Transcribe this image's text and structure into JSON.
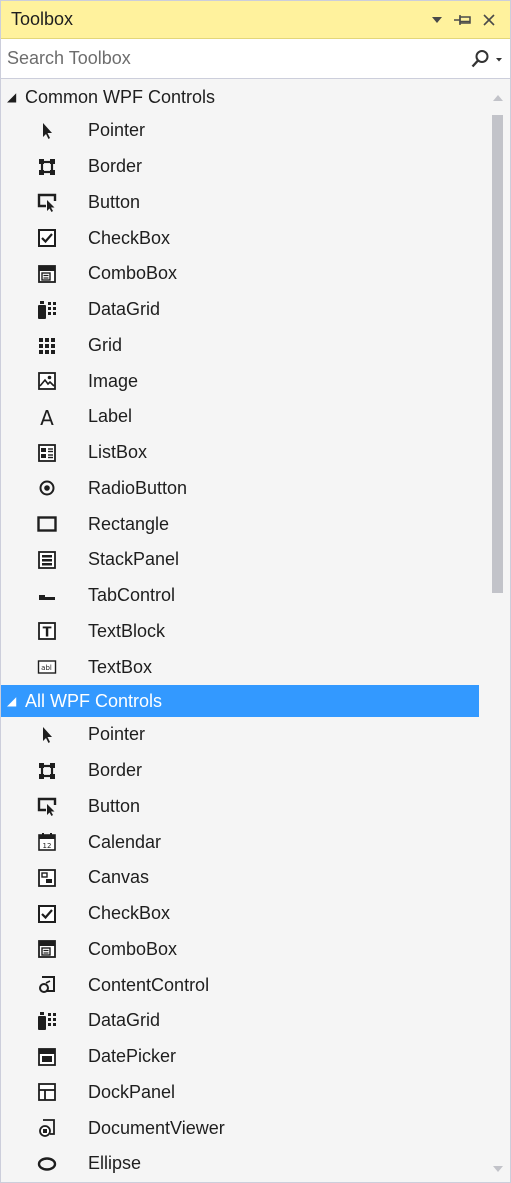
{
  "panel": {
    "title": "Toolbox"
  },
  "search": {
    "placeholder": "Search Toolbox"
  },
  "groups": [
    {
      "label": "Common WPF Controls",
      "items": [
        {
          "label": "Pointer",
          "icon": "pointer-icon"
        },
        {
          "label": "Border",
          "icon": "border-icon"
        },
        {
          "label": "Button",
          "icon": "button-icon"
        },
        {
          "label": "CheckBox",
          "icon": "checkbox-icon"
        },
        {
          "label": "ComboBox",
          "icon": "combobox-icon"
        },
        {
          "label": "DataGrid",
          "icon": "datagrid-icon"
        },
        {
          "label": "Grid",
          "icon": "grid-icon"
        },
        {
          "label": "Image",
          "icon": "image-icon"
        },
        {
          "label": "Label",
          "icon": "label-icon"
        },
        {
          "label": "ListBox",
          "icon": "listbox-icon"
        },
        {
          "label": "RadioButton",
          "icon": "radiobutton-icon"
        },
        {
          "label": "Rectangle",
          "icon": "rectangle-icon"
        },
        {
          "label": "StackPanel",
          "icon": "stackpanel-icon"
        },
        {
          "label": "TabControl",
          "icon": "tabcontrol-icon"
        },
        {
          "label": "TextBlock",
          "icon": "textblock-icon"
        },
        {
          "label": "TextBox",
          "icon": "textbox-icon"
        }
      ]
    },
    {
      "label": "All WPF Controls",
      "items": [
        {
          "label": "Pointer",
          "icon": "pointer-icon"
        },
        {
          "label": "Border",
          "icon": "border-icon"
        },
        {
          "label": "Button",
          "icon": "button-icon"
        },
        {
          "label": "Calendar",
          "icon": "calendar-icon"
        },
        {
          "label": "Canvas",
          "icon": "canvas-icon"
        },
        {
          "label": "CheckBox",
          "icon": "checkbox-icon"
        },
        {
          "label": "ComboBox",
          "icon": "combobox-icon"
        },
        {
          "label": "ContentControl",
          "icon": "contentcontrol-icon"
        },
        {
          "label": "DataGrid",
          "icon": "datagrid-icon"
        },
        {
          "label": "DatePicker",
          "icon": "datepicker-icon"
        },
        {
          "label": "DockPanel",
          "icon": "dockpanel-icon"
        },
        {
          "label": "DocumentViewer",
          "icon": "documentviewer-icon"
        },
        {
          "label": "Ellipse",
          "icon": "ellipse-icon"
        }
      ]
    }
  ],
  "colors": {
    "titlebar": "#fff29d",
    "selection": "#3399ff",
    "background": "#f5f5f5"
  }
}
